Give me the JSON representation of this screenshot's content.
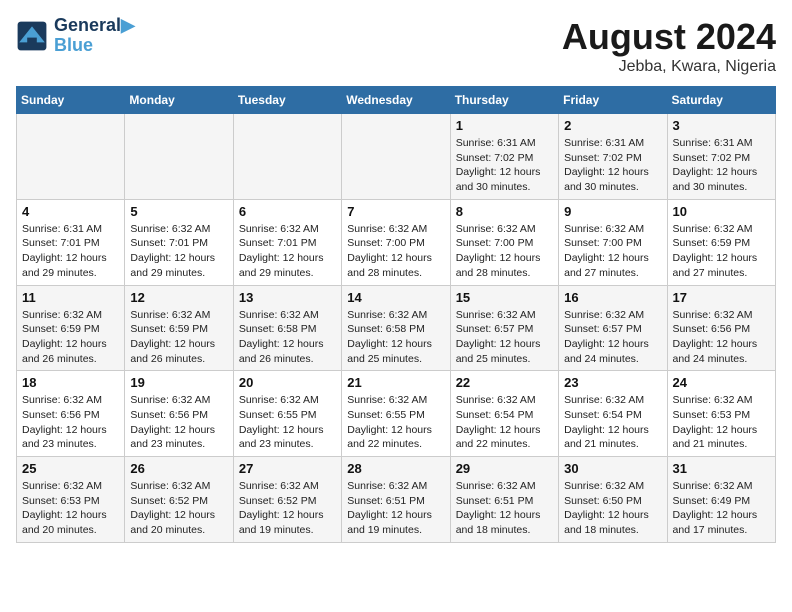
{
  "header": {
    "logo_line1": "General",
    "logo_line2": "Blue",
    "title": "August 2024",
    "subtitle": "Jebba, Kwara, Nigeria"
  },
  "weekdays": [
    "Sunday",
    "Monday",
    "Tuesday",
    "Wednesday",
    "Thursday",
    "Friday",
    "Saturday"
  ],
  "weeks": [
    [
      {
        "day": "",
        "info": ""
      },
      {
        "day": "",
        "info": ""
      },
      {
        "day": "",
        "info": ""
      },
      {
        "day": "",
        "info": ""
      },
      {
        "day": "1",
        "info": "Sunrise: 6:31 AM\nSunset: 7:02 PM\nDaylight: 12 hours\nand 30 minutes."
      },
      {
        "day": "2",
        "info": "Sunrise: 6:31 AM\nSunset: 7:02 PM\nDaylight: 12 hours\nand 30 minutes."
      },
      {
        "day": "3",
        "info": "Sunrise: 6:31 AM\nSunset: 7:02 PM\nDaylight: 12 hours\nand 30 minutes."
      }
    ],
    [
      {
        "day": "4",
        "info": "Sunrise: 6:31 AM\nSunset: 7:01 PM\nDaylight: 12 hours\nand 29 minutes."
      },
      {
        "day": "5",
        "info": "Sunrise: 6:32 AM\nSunset: 7:01 PM\nDaylight: 12 hours\nand 29 minutes."
      },
      {
        "day": "6",
        "info": "Sunrise: 6:32 AM\nSunset: 7:01 PM\nDaylight: 12 hours\nand 29 minutes."
      },
      {
        "day": "7",
        "info": "Sunrise: 6:32 AM\nSunset: 7:00 PM\nDaylight: 12 hours\nand 28 minutes."
      },
      {
        "day": "8",
        "info": "Sunrise: 6:32 AM\nSunset: 7:00 PM\nDaylight: 12 hours\nand 28 minutes."
      },
      {
        "day": "9",
        "info": "Sunrise: 6:32 AM\nSunset: 7:00 PM\nDaylight: 12 hours\nand 27 minutes."
      },
      {
        "day": "10",
        "info": "Sunrise: 6:32 AM\nSunset: 6:59 PM\nDaylight: 12 hours\nand 27 minutes."
      }
    ],
    [
      {
        "day": "11",
        "info": "Sunrise: 6:32 AM\nSunset: 6:59 PM\nDaylight: 12 hours\nand 26 minutes."
      },
      {
        "day": "12",
        "info": "Sunrise: 6:32 AM\nSunset: 6:59 PM\nDaylight: 12 hours\nand 26 minutes."
      },
      {
        "day": "13",
        "info": "Sunrise: 6:32 AM\nSunset: 6:58 PM\nDaylight: 12 hours\nand 26 minutes."
      },
      {
        "day": "14",
        "info": "Sunrise: 6:32 AM\nSunset: 6:58 PM\nDaylight: 12 hours\nand 25 minutes."
      },
      {
        "day": "15",
        "info": "Sunrise: 6:32 AM\nSunset: 6:57 PM\nDaylight: 12 hours\nand 25 minutes."
      },
      {
        "day": "16",
        "info": "Sunrise: 6:32 AM\nSunset: 6:57 PM\nDaylight: 12 hours\nand 24 minutes."
      },
      {
        "day": "17",
        "info": "Sunrise: 6:32 AM\nSunset: 6:56 PM\nDaylight: 12 hours\nand 24 minutes."
      }
    ],
    [
      {
        "day": "18",
        "info": "Sunrise: 6:32 AM\nSunset: 6:56 PM\nDaylight: 12 hours\nand 23 minutes."
      },
      {
        "day": "19",
        "info": "Sunrise: 6:32 AM\nSunset: 6:56 PM\nDaylight: 12 hours\nand 23 minutes."
      },
      {
        "day": "20",
        "info": "Sunrise: 6:32 AM\nSunset: 6:55 PM\nDaylight: 12 hours\nand 23 minutes."
      },
      {
        "day": "21",
        "info": "Sunrise: 6:32 AM\nSunset: 6:55 PM\nDaylight: 12 hours\nand 22 minutes."
      },
      {
        "day": "22",
        "info": "Sunrise: 6:32 AM\nSunset: 6:54 PM\nDaylight: 12 hours\nand 22 minutes."
      },
      {
        "day": "23",
        "info": "Sunrise: 6:32 AM\nSunset: 6:54 PM\nDaylight: 12 hours\nand 21 minutes."
      },
      {
        "day": "24",
        "info": "Sunrise: 6:32 AM\nSunset: 6:53 PM\nDaylight: 12 hours\nand 21 minutes."
      }
    ],
    [
      {
        "day": "25",
        "info": "Sunrise: 6:32 AM\nSunset: 6:53 PM\nDaylight: 12 hours\nand 20 minutes."
      },
      {
        "day": "26",
        "info": "Sunrise: 6:32 AM\nSunset: 6:52 PM\nDaylight: 12 hours\nand 20 minutes."
      },
      {
        "day": "27",
        "info": "Sunrise: 6:32 AM\nSunset: 6:52 PM\nDaylight: 12 hours\nand 19 minutes."
      },
      {
        "day": "28",
        "info": "Sunrise: 6:32 AM\nSunset: 6:51 PM\nDaylight: 12 hours\nand 19 minutes."
      },
      {
        "day": "29",
        "info": "Sunrise: 6:32 AM\nSunset: 6:51 PM\nDaylight: 12 hours\nand 18 minutes."
      },
      {
        "day": "30",
        "info": "Sunrise: 6:32 AM\nSunset: 6:50 PM\nDaylight: 12 hours\nand 18 minutes."
      },
      {
        "day": "31",
        "info": "Sunrise: 6:32 AM\nSunset: 6:49 PM\nDaylight: 12 hours\nand 17 minutes."
      }
    ]
  ]
}
